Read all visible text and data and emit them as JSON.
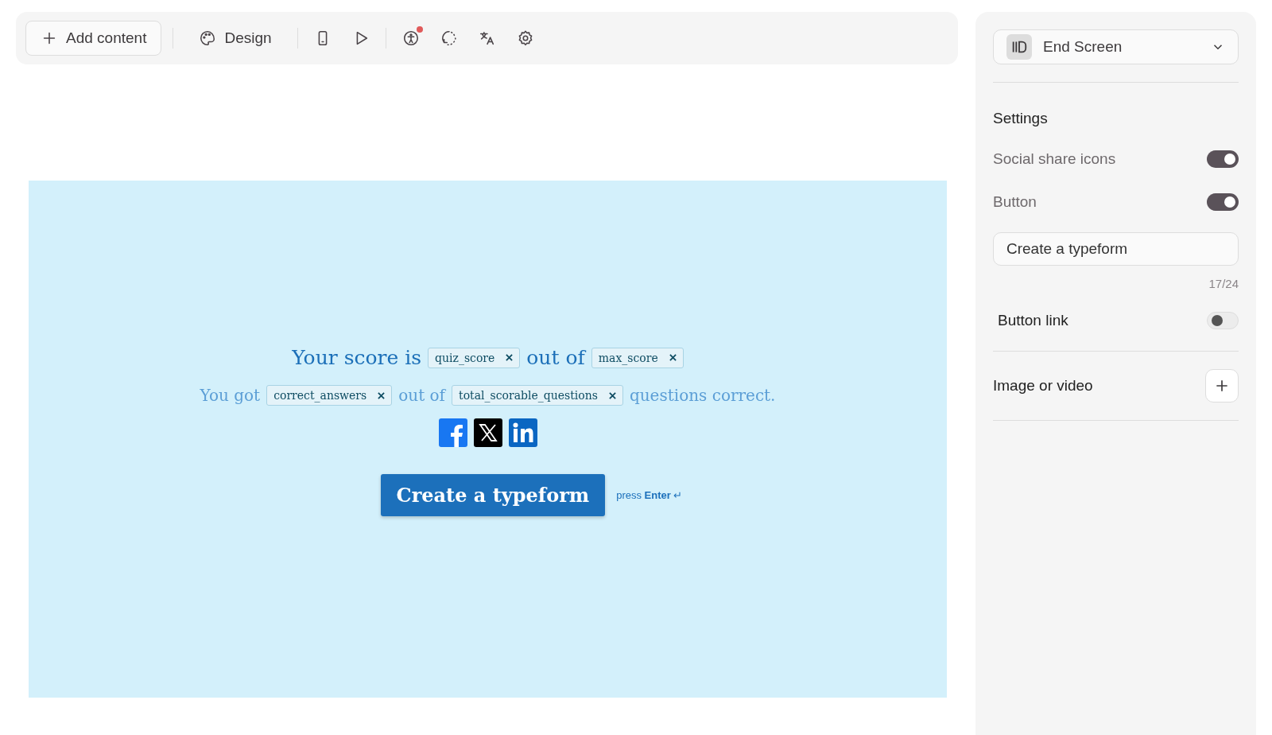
{
  "toolbar": {
    "add_button": "Add content",
    "design_button": "Design",
    "accessibility_alert": true
  },
  "end_screen": {
    "line_1": [
      {
        "kind": "text",
        "text": "Your score is"
      },
      {
        "kind": "tag",
        "text": "quiz_score"
      },
      {
        "kind": "text",
        "text": "out of"
      },
      {
        "kind": "tag",
        "text": "max_score"
      }
    ],
    "line_2": [
      {
        "kind": "text",
        "text": "You got"
      },
      {
        "kind": "tag",
        "text": "correct_answers"
      },
      {
        "kind": "text",
        "text": "out of"
      },
      {
        "kind": "tag",
        "text": "total_scorable_questions"
      },
      {
        "kind": "text",
        "text": "questions correct."
      }
    ],
    "social_icons": [
      {
        "kind": "facebook"
      },
      {
        "kind": "x"
      },
      {
        "kind": "linkedin"
      }
    ],
    "button": "Create a typeform",
    "hint": "press **Enter** ↵"
  },
  "panel": {
    "block_type": "End Screen",
    "section_title": "Settings",
    "rows": [
      {
        "kind": "toggle",
        "label": "Social share icons",
        "on": true
      },
      {
        "kind": "toggle",
        "label": "Button",
        "on": true
      },
      {
        "kind": "field",
        "value": "Create a typeform",
        "counter": "17/24"
      },
      {
        "kind": "subtoggle",
        "label": "Button link",
        "on": false
      }
    ],
    "media_label": "Image or video"
  }
}
